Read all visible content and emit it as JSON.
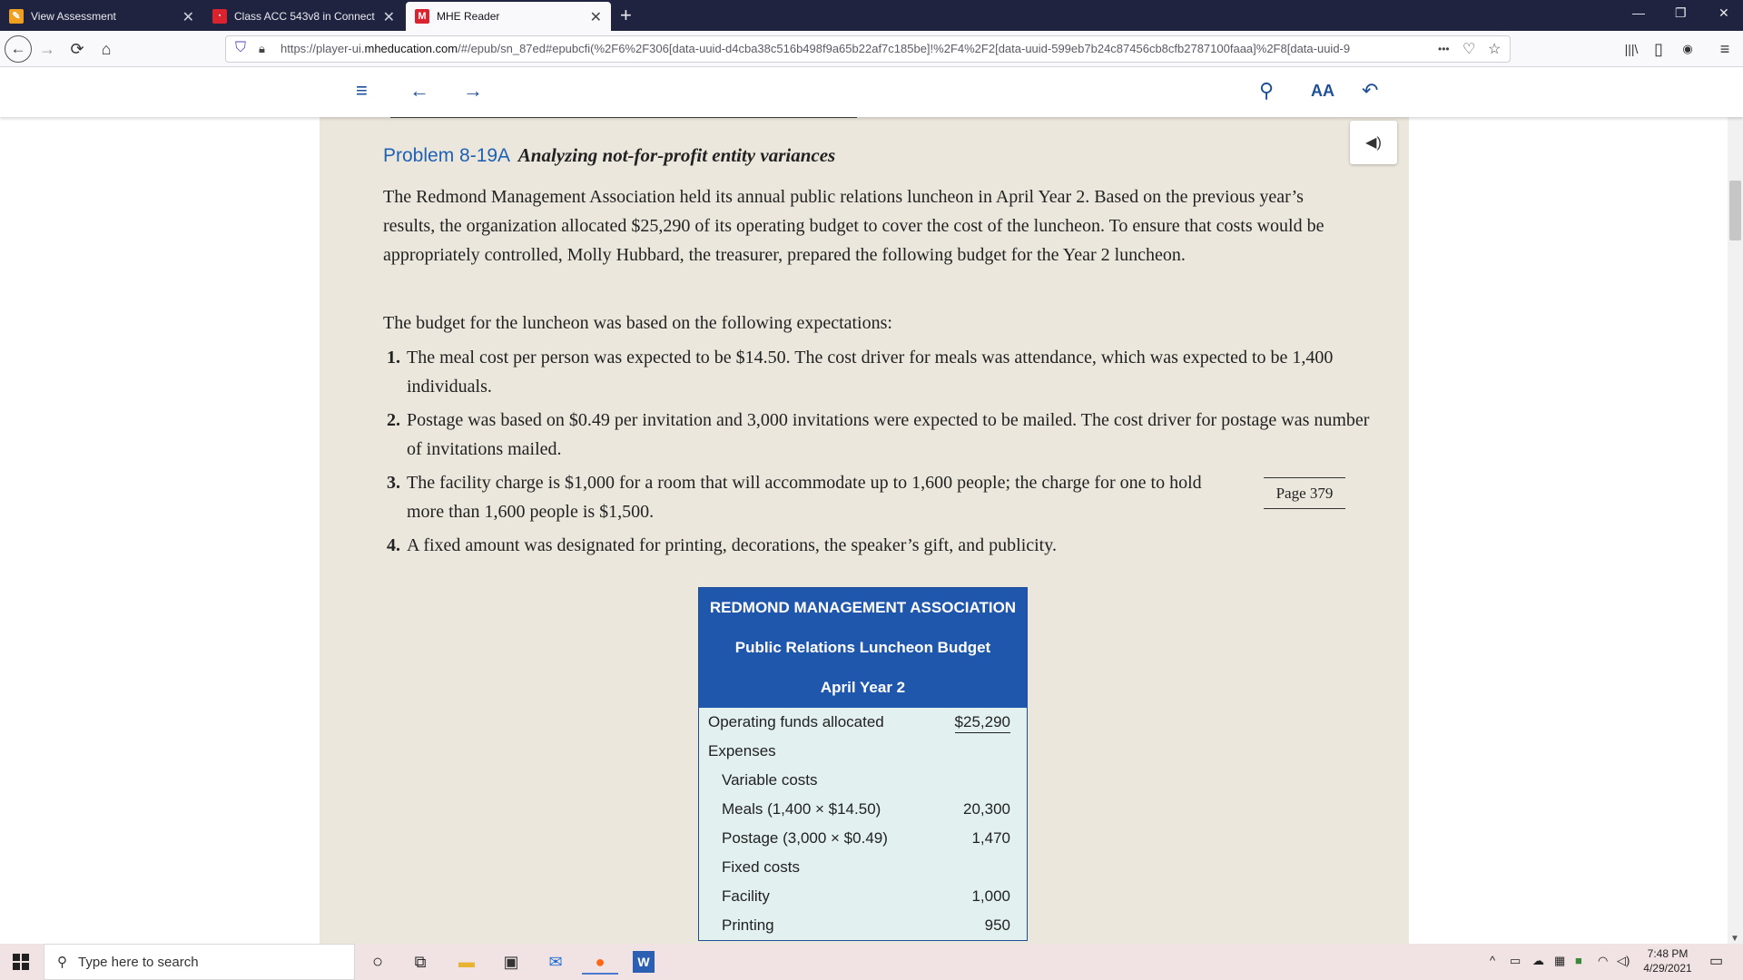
{
  "browser": {
    "tabs": [
      {
        "label": "View Assessment",
        "favicon_color": "#f0a020",
        "active": false
      },
      {
        "label": "Class ACC 543v8 in Connect",
        "favicon_color": "#d9232f",
        "active": false
      },
      {
        "label": "MHE Reader",
        "favicon_color": "#d9232f",
        "favicon_letter": "M",
        "active": true
      }
    ],
    "new_tab_symbol": "+",
    "url": {
      "prefix": "https://player-ui.",
      "host": "mheducation.com",
      "path": "/#/epub/sn_87ed#epubcfi(%2F6%2F306[data-uuid-d4cba38c516b498f9a65b22af7c185be]!%2F4%2F2[data-uuid-599eb7b24c87456cb8cfb2787100faaa]%2F8[data-uuid-9"
    },
    "more_symbol": "•••"
  },
  "reader": {
    "problem_number": "Problem 8-19A",
    "problem_title": "Analyzing not-for-profit entity variances",
    "intro_paragraph": "The Redmond Management Association held its annual public relations luncheon in April Year 2. Based on the previous year’s results, the organization allocated $25,290 of its operating budget to cover the cost of the luncheon. To ensure that costs would be appropriately controlled, Molly Hubbard, the treasurer, prepared the following budget for the Year 2 luncheon.",
    "expectations_lead": "The budget for the luncheon was based on the following expectations:",
    "expectations": [
      {
        "num": "1.",
        "text": "The meal cost per person was expected to be $14.50. The cost driver for meals was attendance, which was expected to be 1,400 individuals."
      },
      {
        "num": "2.",
        "text": "Postage was based on $0.49 per invitation and 3,000 invitations were expected to be mailed. The cost driver for postage was number of invitations mailed."
      },
      {
        "num": "3.",
        "text": "The facility charge is $1,000 for a room that will accommodate up to 1,600 people; the charge for one to hold more than 1,600 people is $1,500."
      },
      {
        "num": "4.",
        "text": "A fixed amount was designated for printing, decorations, the speaker’s gift, and publicity."
      }
    ],
    "page_marker": "Page 379",
    "budget_table": {
      "title_lines": [
        "REDMOND MANAGEMENT ASSOCIATION",
        "Public Relations Luncheon Budget",
        "April Year 2"
      ],
      "rows": [
        {
          "label": "Operating funds allocated",
          "value": "$25,290",
          "indent": false,
          "underline": true
        },
        {
          "label": "Expenses",
          "value": "",
          "indent": false,
          "underline": false
        },
        {
          "label": "Variable costs",
          "value": "",
          "indent": true,
          "underline": false
        },
        {
          "label": "Meals (1,400 × $14.50)",
          "value": "20,300",
          "indent": true,
          "underline": false
        },
        {
          "label": "Postage (3,000 × $0.49)",
          "value": "1,470",
          "indent": true,
          "underline": false
        },
        {
          "label": "Fixed costs",
          "value": "",
          "indent": true,
          "underline": false
        },
        {
          "label": "Facility",
          "value": "1,000",
          "indent": true,
          "underline": false
        },
        {
          "label": "Printing",
          "value": "950",
          "indent": true,
          "underline": false
        }
      ]
    }
  },
  "taskbar": {
    "search_placeholder": "Type here to search",
    "time": "7:48 PM",
    "date": "4/29/2021"
  },
  "colors": {
    "accent_blue": "#1f57ad",
    "page_bg": "#ebe7dd",
    "table_bg": "#e2f1ef"
  }
}
